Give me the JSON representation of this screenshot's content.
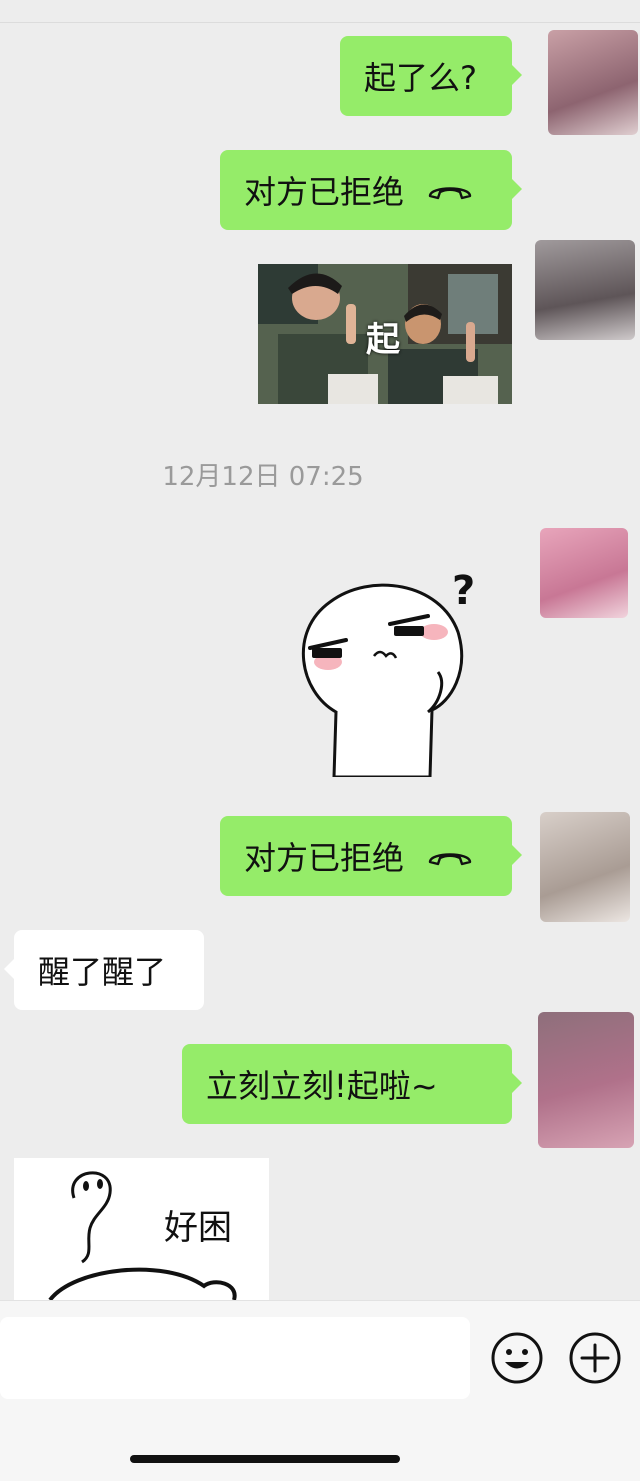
{
  "messages": {
    "m1": "起了么?",
    "m2": "对方已拒绝",
    "m3_photo_caption": "起",
    "timestamp": "12月12日 07:25",
    "m5": "对方已拒绝",
    "m6": "醒了醒了",
    "m7": "立刻立刻!起啦~",
    "m8_sticker_text": "好困"
  },
  "icons": {
    "call_declined": "phone-hangup-icon",
    "emoji": "emoji-icon",
    "more": "plus-icon"
  },
  "colors": {
    "outgoing_bubble": "#95ec69",
    "incoming_bubble": "#ffffff",
    "background": "#ededed"
  }
}
